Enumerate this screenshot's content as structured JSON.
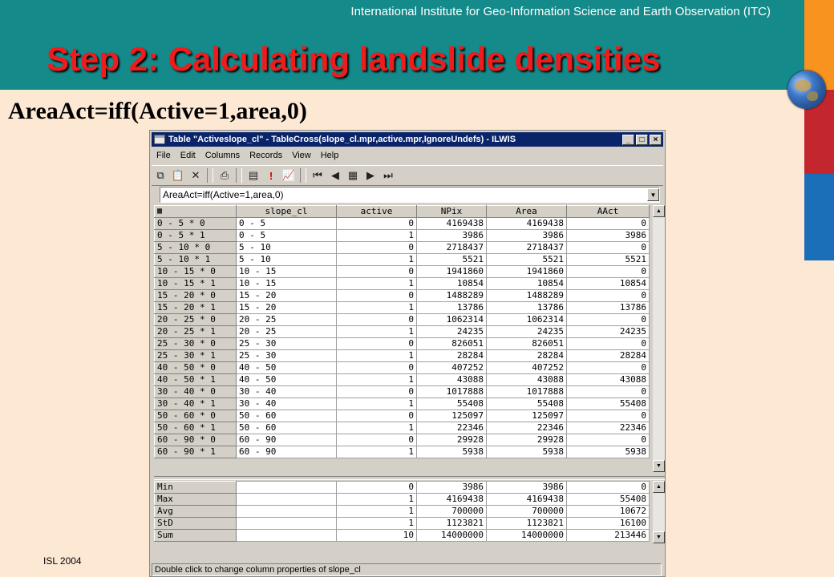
{
  "slide": {
    "institute": "International Institute for Geo-Information Science and Earth Observation (ITC)",
    "title": "Step 2: Calculating landslide densities",
    "formula_heading": "AreaAct=iff(Active=1,area,0)",
    "footer": "ISL 2004",
    "colors": {
      "header": "#158a8a",
      "title": "#ee1c1c",
      "strip": [
        "#f7931e",
        "#c4262e",
        "#1b6fb8"
      ]
    }
  },
  "window": {
    "title": "Table \"Activeslope_cl\" - TableCross(slope_cl.mpr,active.mpr,IgnoreUndefs) - ILWIS",
    "buttons": {
      "minimize": "_",
      "maximize": "□",
      "close": "×"
    },
    "menu": [
      "File",
      "Edit",
      "Columns",
      "Records",
      "View",
      "Help"
    ],
    "toolbar_icons": [
      "copy-icon",
      "paste-icon",
      "delete-icon",
      "print-icon",
      "properties-icon",
      "exclamation-icon",
      "graph-icon",
      "first-record-icon",
      "previous-record-icon",
      "goto-record-icon",
      "next-record-icon",
      "last-record-icon"
    ],
    "command_line": "AreaAct=iff(Active=1,area,0)",
    "statusbar": "Double click to change column properties of slope_cl"
  },
  "table": {
    "columns": [
      "slope_cl",
      "active",
      "NPix",
      "Area",
      "AAct"
    ],
    "rows": [
      {
        "key": "0 - 5 * 0",
        "slope_cl": "0 - 5",
        "active": "0",
        "npix": "4169438",
        "area": "4169438",
        "aact": "0"
      },
      {
        "key": "0 - 5 * 1",
        "slope_cl": "0 - 5",
        "active": "1",
        "npix": "3986",
        "area": "3986",
        "aact": "3986"
      },
      {
        "key": "5 - 10 * 0",
        "slope_cl": "5 - 10",
        "active": "0",
        "npix": "2718437",
        "area": "2718437",
        "aact": "0"
      },
      {
        "key": "5 - 10 * 1",
        "slope_cl": "5 - 10",
        "active": "1",
        "npix": "5521",
        "area": "5521",
        "aact": "5521"
      },
      {
        "key": "10 - 15 * 0",
        "slope_cl": "10 - 15",
        "active": "0",
        "npix": "1941860",
        "area": "1941860",
        "aact": "0"
      },
      {
        "key": "10 - 15 * 1",
        "slope_cl": "10 - 15",
        "active": "1",
        "npix": "10854",
        "area": "10854",
        "aact": "10854"
      },
      {
        "key": "15 - 20 * 0",
        "slope_cl": "15 - 20",
        "active": "0",
        "npix": "1488289",
        "area": "1488289",
        "aact": "0"
      },
      {
        "key": "15 - 20 * 1",
        "slope_cl": "15 - 20",
        "active": "1",
        "npix": "13786",
        "area": "13786",
        "aact": "13786"
      },
      {
        "key": "20 - 25 * 0",
        "slope_cl": "20 - 25",
        "active": "0",
        "npix": "1062314",
        "area": "1062314",
        "aact": "0"
      },
      {
        "key": "20 - 25 * 1",
        "slope_cl": "20 - 25",
        "active": "1",
        "npix": "24235",
        "area": "24235",
        "aact": "24235"
      },
      {
        "key": "25 - 30 * 0",
        "slope_cl": "25 - 30",
        "active": "0",
        "npix": "826051",
        "area": "826051",
        "aact": "0"
      },
      {
        "key": "25 - 30 * 1",
        "slope_cl": "25 - 30",
        "active": "1",
        "npix": "28284",
        "area": "28284",
        "aact": "28284"
      },
      {
        "key": "40 - 50 * 0",
        "slope_cl": "40 - 50",
        "active": "0",
        "npix": "407252",
        "area": "407252",
        "aact": "0"
      },
      {
        "key": "40 - 50 * 1",
        "slope_cl": "40 - 50",
        "active": "1",
        "npix": "43088",
        "area": "43088",
        "aact": "43088"
      },
      {
        "key": "30 - 40 * 0",
        "slope_cl": "30 - 40",
        "active": "0",
        "npix": "1017888",
        "area": "1017888",
        "aact": "0"
      },
      {
        "key": "30 - 40 * 1",
        "slope_cl": "30 - 40",
        "active": "1",
        "npix": "55408",
        "area": "55408",
        "aact": "55408"
      },
      {
        "key": "50 - 60 * 0",
        "slope_cl": "50 - 60",
        "active": "0",
        "npix": "125097",
        "area": "125097",
        "aact": "0"
      },
      {
        "key": "50 - 60 * 1",
        "slope_cl": "50 - 60",
        "active": "1",
        "npix": "22346",
        "area": "22346",
        "aact": "22346"
      },
      {
        "key": "60 - 90 * 0",
        "slope_cl": "60 - 90",
        "active": "0",
        "npix": "29928",
        "area": "29928",
        "aact": "0"
      },
      {
        "key": "60 - 90 * 1",
        "slope_cl": "60 - 90",
        "active": "1",
        "npix": "5938",
        "area": "5938",
        "aact": "5938"
      }
    ],
    "stats": [
      {
        "key": "Min",
        "slope_cl": "",
        "active": "0",
        "npix": "3986",
        "area": "3986",
        "aact": "0"
      },
      {
        "key": "Max",
        "slope_cl": "",
        "active": "1",
        "npix": "4169438",
        "area": "4169438",
        "aact": "55408"
      },
      {
        "key": "Avg",
        "slope_cl": "",
        "active": "1",
        "npix": "700000",
        "area": "700000",
        "aact": "10672"
      },
      {
        "key": "StD",
        "slope_cl": "",
        "active": "1",
        "npix": "1123821",
        "area": "1123821",
        "aact": "16100"
      },
      {
        "key": "Sum",
        "slope_cl": "",
        "active": "10",
        "npix": "14000000",
        "area": "14000000",
        "aact": "213446"
      }
    ]
  }
}
